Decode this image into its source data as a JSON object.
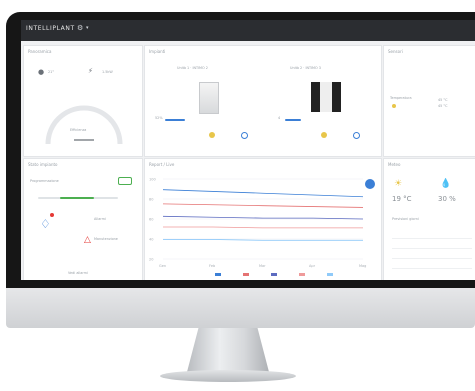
{
  "brand": {
    "name": "INTELLIPLANT"
  },
  "colors": {
    "accent": "#3b7fd6",
    "warning": "#e8c64a",
    "alert": "#e53935",
    "success": "#4caf50"
  },
  "panels": {
    "overview": {
      "title": "Panoramica",
      "value_left": "21°",
      "value_right": "1.5kW",
      "gauge_label": "Efficienza"
    },
    "plant": {
      "title": "Impianti",
      "unit1": "Unità 1 · INTIMO 2",
      "unit2": "Unità 2 · INTIMO 3",
      "val1": "52%",
      "val2": "4"
    },
    "side": {
      "title": "Sensori",
      "rows": [
        "Temperatura",
        "45 °C",
        "45 °C"
      ]
    },
    "alarms": {
      "title": "Stato impianto",
      "label1": "Programmazione",
      "label2": "Allarmi",
      "label3": "Manutenzione",
      "footer": "Vedi allarmi"
    },
    "chart": {
      "title": "Report / Live"
    },
    "weather": {
      "title": "Meteo",
      "temp1": "19 °C",
      "temp2": "30 %",
      "subtitle": "Previsioni giorni"
    }
  },
  "chart_data": {
    "type": "line",
    "x": [
      "Gen",
      "Feb",
      "Mar",
      "Apr",
      "Mag"
    ],
    "series": [
      {
        "values": [
          78,
          76,
          74,
          72,
          70
        ]
      },
      {
        "values": [
          62,
          61,
          60,
          59,
          58
        ]
      },
      {
        "values": [
          48,
          47,
          46,
          46,
          45
        ]
      },
      {
        "values": [
          36,
          36,
          35,
          35,
          35
        ]
      },
      {
        "values": [
          22,
          22,
          21,
          21,
          21
        ]
      }
    ],
    "colors": [
      "#3b7fd6",
      "#e57373",
      "#5c6bc0",
      "#ef9a9a",
      "#90caf9"
    ],
    "ylim": [
      0,
      90
    ],
    "grid": true,
    "tick_labels": [
      "100",
      "80",
      "60",
      "40",
      "20"
    ]
  }
}
